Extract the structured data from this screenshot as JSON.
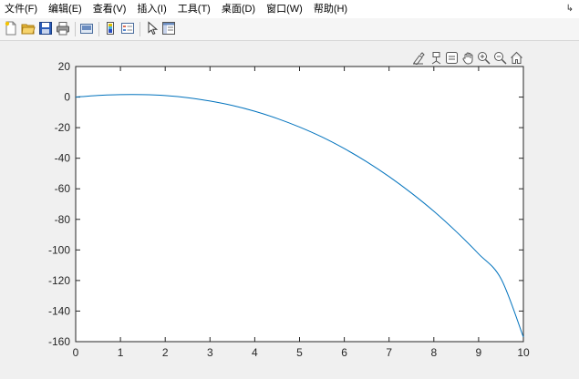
{
  "menu": [
    {
      "label": "文件(F)"
    },
    {
      "label": "编辑(E)"
    },
    {
      "label": "查看(V)"
    },
    {
      "label": "插入(I)"
    },
    {
      "label": "工具(T)"
    },
    {
      "label": "桌面(D)"
    },
    {
      "label": "窗口(W)"
    },
    {
      "label": "帮助(H)"
    }
  ],
  "toolbar_icons": [
    "new-figure-icon",
    "open-file-icon",
    "save-icon",
    "print-icon",
    "link-plot-icon",
    "colorbar-icon",
    "legend-icon",
    "pointer-icon",
    "property-inspector-icon"
  ],
  "axes_toolbar_icons": [
    "brush-icon",
    "data-tips-icon",
    "restore-view-icon",
    "pan-icon",
    "zoom-in-icon",
    "zoom-out-icon",
    "home-icon"
  ],
  "colors": {
    "line": "#0072bd",
    "axes_bg": "#ffffff",
    "figure_bg": "#f0f0f0"
  },
  "chart_data": {
    "type": "line",
    "title": "",
    "xlabel": "",
    "ylabel": "",
    "xlim": [
      0,
      10
    ],
    "ylim": [
      -160,
      20
    ],
    "xticks": [
      "0",
      "1",
      "2",
      "3",
      "4",
      "5",
      "6",
      "7",
      "8",
      "9",
      "10"
    ],
    "yticks": [
      "20",
      "0",
      "-20",
      "-40",
      "-60",
      "-80",
      "-100",
      "-120",
      "-140",
      "-160"
    ],
    "grid": false,
    "series": [
      {
        "x": [
          0,
          0.5,
          1,
          1.5,
          2,
          2.5,
          3,
          3.5,
          4,
          4.5,
          5,
          5.5,
          6,
          6.5,
          7,
          7.5,
          8,
          8.5,
          9,
          9.5,
          10
        ],
        "y": [
          0,
          1.1,
          1.6,
          1.6,
          1.0,
          -0.4,
          -2.6,
          -5.5,
          -9.3,
          -14.0,
          -19.6,
          -26.1,
          -33.7,
          -42.3,
          -52.0,
          -62.8,
          -74.7,
          -88.0,
          -102.6,
          -118.8,
          -157.0
        ]
      }
    ]
  }
}
